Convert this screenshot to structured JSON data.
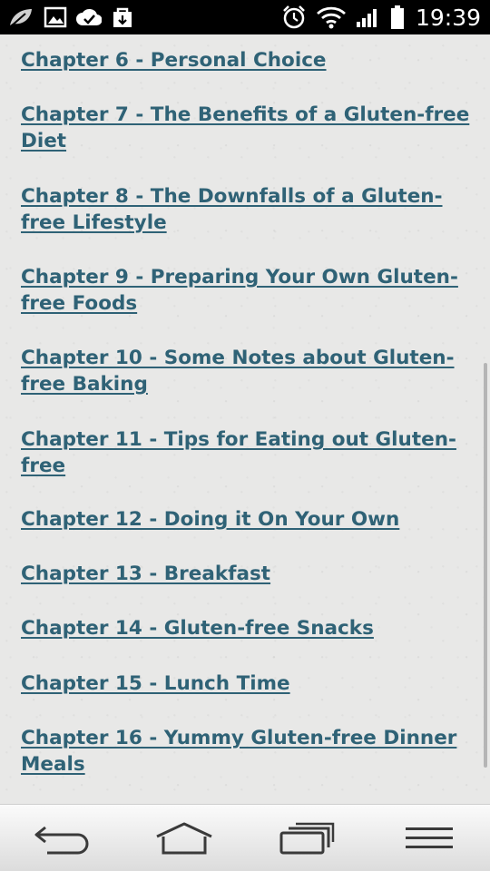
{
  "status_bar": {
    "time": "19:39",
    "left_icons": [
      "leaf-icon",
      "image-icon",
      "check-icon",
      "shopping-bag-icon"
    ],
    "right_icons": [
      "alarm-icon",
      "wifi-icon",
      "signal-icon",
      "battery-icon"
    ]
  },
  "chapters": [
    {
      "label": "Chapter 6 - Personal Choice"
    },
    {
      "label": "Chapter 7 - The Benefits of a Gluten-free Diet"
    },
    {
      "label": "Chapter 8 - The Downfalls of a Gluten-free Lifestyle"
    },
    {
      "label": "Chapter 9 - Preparing Your Own Gluten-free Foods"
    },
    {
      "label": "Chapter 10 - Some Notes about Gluten-free Baking"
    },
    {
      "label": "Chapter 11 - Tips for Eating out Gluten-free"
    },
    {
      "label": "Chapter 12 - Doing it On Your Own"
    },
    {
      "label": "Chapter 13 - Breakfast"
    },
    {
      "label": "Chapter 14 - Gluten-free Snacks"
    },
    {
      "label": "Chapter 15 - Lunch Time"
    },
    {
      "label": "Chapter 16 - Yummy Gluten-free Dinner Meals"
    }
  ],
  "nav_bar": {
    "buttons": [
      "back-icon",
      "home-icon",
      "recent-apps-icon",
      "menu-icon"
    ]
  },
  "colors": {
    "link": "#2f6276",
    "background": "#e8e8e7",
    "status_bar": "#000000"
  }
}
